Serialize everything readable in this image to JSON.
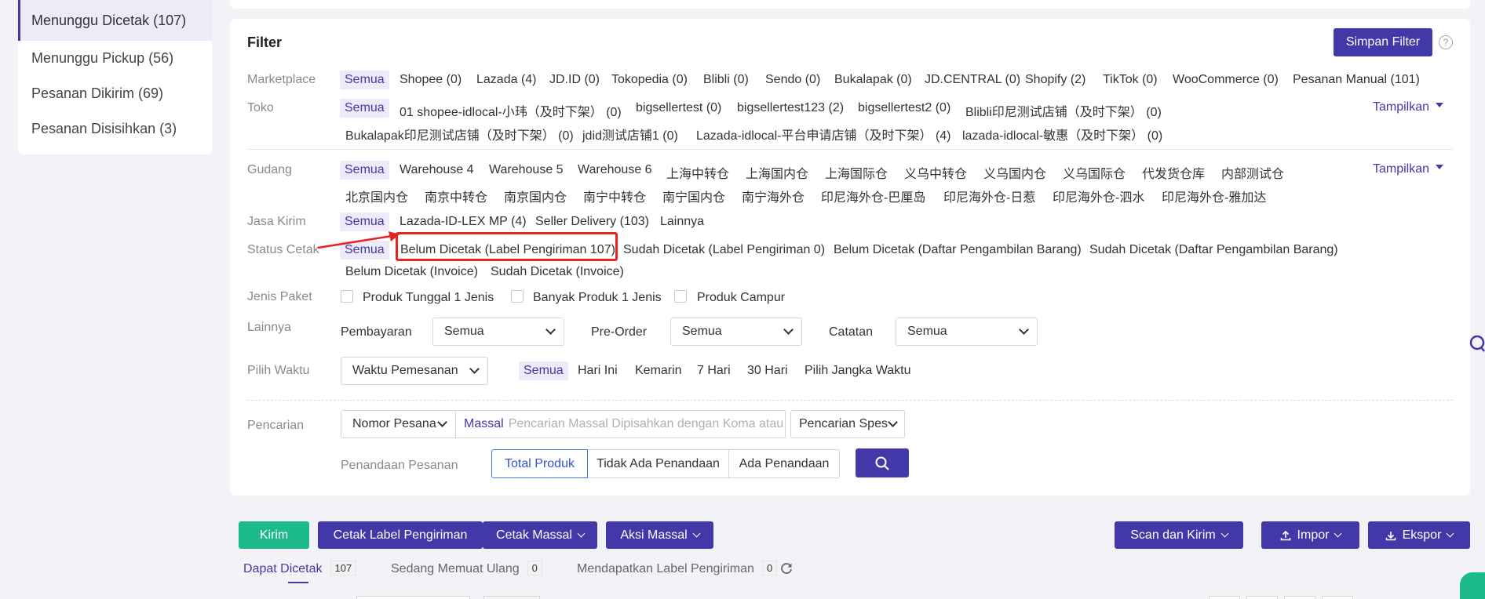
{
  "sidebar": {
    "items": [
      {
        "label": "Menunggu Dicetak (107)",
        "active": true
      },
      {
        "label": "Menunggu Pickup (56)"
      },
      {
        "label": "Pesanan Dikirim (69)"
      },
      {
        "label": "Pesanan Disisihkan (3)"
      }
    ]
  },
  "filter": {
    "title": "Filter",
    "save_button": "Simpan Filter",
    "help_icon": "?",
    "show_more": "Tampilkan",
    "marketplace": {
      "label": "Marketplace",
      "all": "Semua",
      "options": [
        "Shopee (0)",
        "Lazada (4)",
        "JD.ID (0)",
        "Tokopedia (0)",
        "Blibli (0)",
        "Sendo (0)",
        "Bukalapak (0)",
        "JD.CENTRAL (0)",
        "Shopify (2)",
        "TikTok (0)",
        "WooCommerce (0)",
        "Pesanan Manual (101)"
      ]
    },
    "toko": {
      "label": "Toko",
      "all": "Semua",
      "row1": [
        "01 shopee-idlocal-小玮（及时下架） (0)",
        "bigsellertest (0)",
        "bigsellertest123 (2)",
        "bigsellertest2 (0)",
        "Blibli印尼测试店铺（及时下架） (0)"
      ],
      "row2": [
        "Bukalapak印尼测试店铺（及时下架） (0)",
        "jdid测试店铺1 (0)",
        "Lazada-idlocal-平台申请店铺（及时下架） (4)",
        "lazada-idlocal-敏惠（及时下架） (0)"
      ]
    },
    "gudang": {
      "label": "Gudang",
      "all": "Semua",
      "row1": [
        "Warehouse 4",
        "Warehouse 5",
        "Warehouse 6",
        "上海中转仓",
        "上海国内仓",
        "上海国际仓",
        "义乌中转仓",
        "义乌国内仓",
        "义乌国际仓",
        "代发货仓库",
        "内部测试仓"
      ],
      "row2": [
        "北京国内仓",
        "南京中转仓",
        "南京国内仓",
        "南宁中转仓",
        "南宁国内仓",
        "南宁海外仓",
        "印尼海外仓-巴厘岛",
        "印尼海外仓-日惹",
        "印尼海外仓-泗水",
        "印尼海外仓-雅加达"
      ]
    },
    "jasa_kirim": {
      "label": "Jasa Kirim",
      "all": "Semua",
      "options": [
        "Lazada-ID-LEX MP (4)",
        "Seller Delivery (103)",
        "Lainnya"
      ]
    },
    "status_cetak": {
      "label": "Status Cetak",
      "all": "Semua",
      "row1": [
        "Belum Dicetak (Label Pengiriman 107)",
        "Sudah Dicetak (Label Pengiriman 0)",
        "Belum Dicetak (Daftar Pengambilan Barang)",
        "Sudah Dicetak (Daftar Pengambilan Barang)"
      ],
      "row2": [
        "Belum Dicetak (Invoice)",
        "Sudah Dicetak (Invoice)"
      ]
    },
    "jenis_paket": {
      "label": "Jenis Paket",
      "options": [
        "Produk Tunggal 1 Jenis",
        "Banyak Produk 1 Jenis",
        "Produk Campur"
      ]
    },
    "lainnya": {
      "label": "Lainnya",
      "pembayaran_label": "Pembayaran",
      "pembayaran_value": "Semua",
      "preorder_label": "Pre-Order",
      "preorder_value": "Semua",
      "catatan_label": "Catatan",
      "catatan_value": "Semua"
    },
    "waktu": {
      "label": "Pilih Waktu",
      "select_value": "Waktu Pemesanan",
      "all": "Semua",
      "options": [
        "Hari Ini",
        "Kemarin",
        "7 Hari",
        "30 Hari",
        "Pilih Jangka Waktu"
      ]
    },
    "pencarian": {
      "label": "Pencarian",
      "type_value": "Nomor Pesana",
      "massal": "Massal",
      "placeholder": "Pencarian Massal Dipisahkan dengan Koma atau S",
      "spec_value": "Pencarian Spes",
      "penandaan_label": "Penandaan Pesanan",
      "segments": [
        "Total Produk",
        "Tidak Ada Penandaan",
        "Ada Penandaan"
      ]
    }
  },
  "actions": {
    "kirim": "Kirim",
    "cetak_label": "Cetak Label Pengiriman",
    "cetak_massal": "Cetak Massal",
    "aksi_massal": "Aksi Massal",
    "scan_kirim": "Scan dan Kirim",
    "impor": "Impor",
    "ekspor": "Ekspor"
  },
  "tabs": [
    {
      "label": "Dapat Dicetak",
      "count": "107",
      "active": true
    },
    {
      "label": "Sedang Memuat Ulang",
      "count": "0"
    },
    {
      "label": "Mendapatkan Label Pengiriman",
      "count": "0"
    }
  ],
  "colors": {
    "primary": "#4338a8",
    "kirim": "#1dbb8a",
    "highlight": "#e8221f"
  }
}
